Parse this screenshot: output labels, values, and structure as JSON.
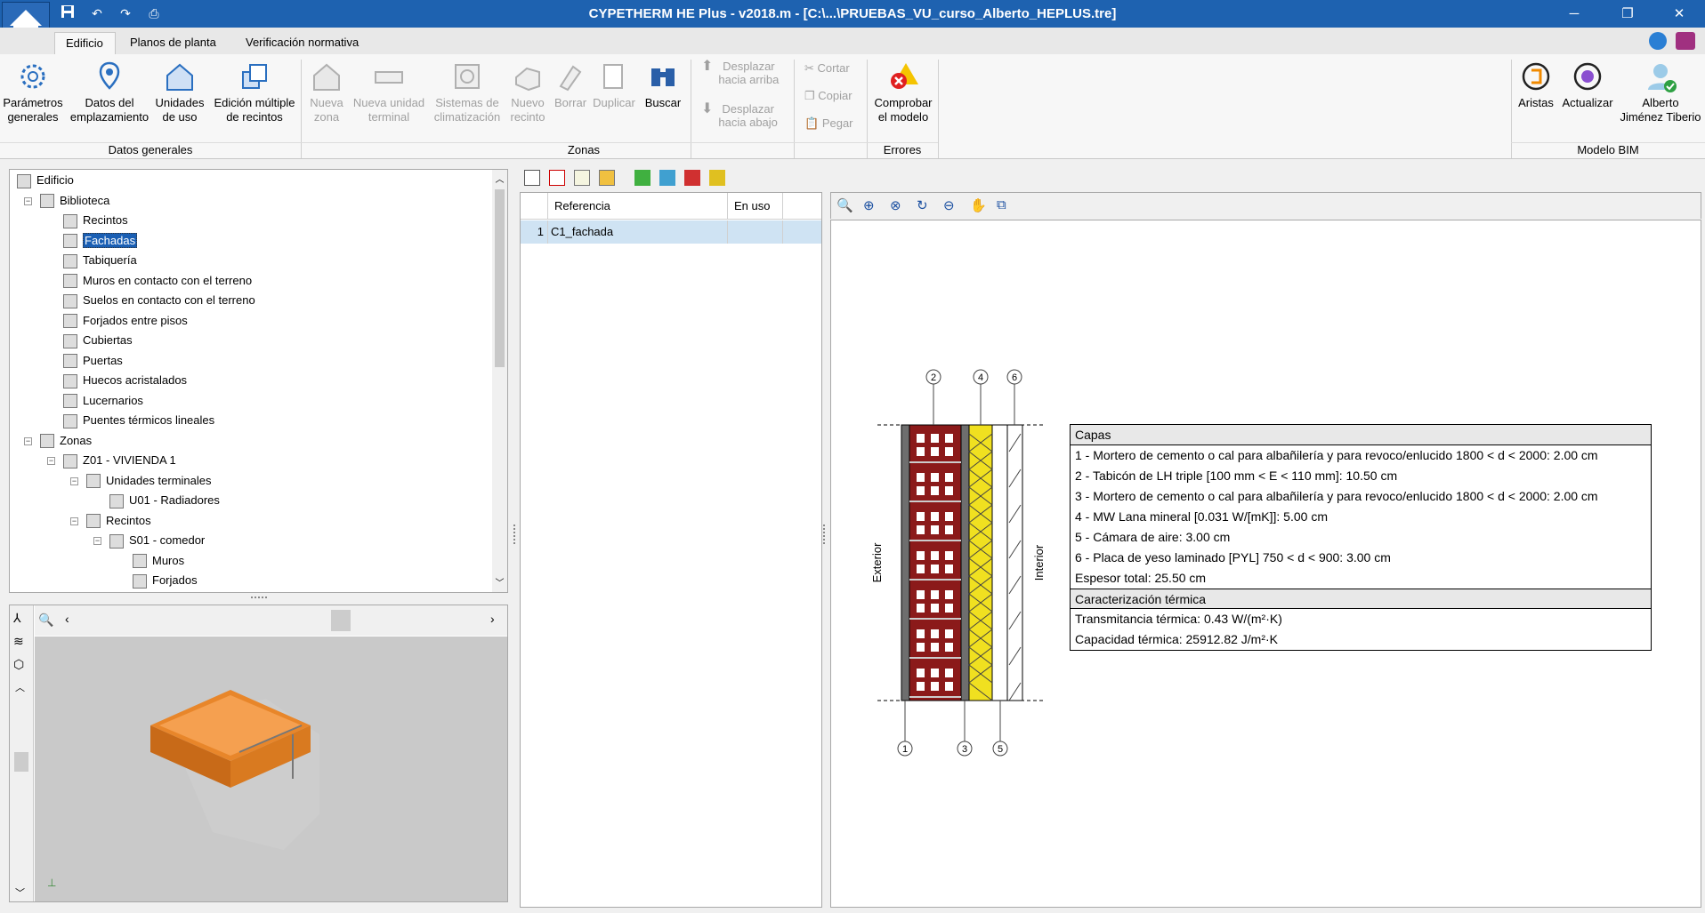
{
  "window": {
    "title": "CYPETHERM HE Plus - v2018.m - [C:\\...\\PRUEBAS_VU_curso_Alberto_HEPLUS.tre]",
    "minimize": "─",
    "restore": "❐",
    "close": "✕"
  },
  "quick_access": {
    "save": "💾",
    "undo": "↶",
    "redo": "↷",
    "print": "⎙"
  },
  "tabs": [
    "Edificio",
    "Planos de planta",
    "Verificación normativa"
  ],
  "ribbon": {
    "datos_generales": {
      "label": "Datos generales",
      "buttons": [
        "Parámetros\ngenerales",
        "Datos del\nemplazamiento",
        "Unidades\nde uso",
        "Edición múltiple\nde recintos"
      ]
    },
    "zonas": {
      "label": "Zonas",
      "buttons": [
        "Nueva\nzona",
        "Nueva unidad\nterminal",
        "Sistemas de\nclimatización",
        "Nuevo\nrecinto",
        "Borrar",
        "Duplicar",
        "Buscar"
      ],
      "move_up": "Desplazar\nhacia arriba",
      "move_down": "Desplazar\nhacia abajo",
      "cut": "Cortar",
      "copy": "Copiar",
      "paste": "Pegar"
    },
    "errores": {
      "label": "Errores",
      "check": "Comprobar\nel modelo"
    },
    "bim": {
      "label": "Modelo BIM",
      "buttons": [
        "Aristas",
        "Actualizar",
        "Alberto\nJiménez Tiberio"
      ]
    }
  },
  "tree": [
    {
      "label": "Edificio",
      "level": 0
    },
    {
      "label": "Biblioteca",
      "level": 1
    },
    {
      "label": "Recintos",
      "level": 2
    },
    {
      "label": "Fachadas",
      "level": 2,
      "selected": true
    },
    {
      "label": "Tabiquería",
      "level": 2
    },
    {
      "label": "Muros en contacto con el terreno",
      "level": 2
    },
    {
      "label": "Suelos en contacto con el terreno",
      "level": 2
    },
    {
      "label": "Forjados entre pisos",
      "level": 2
    },
    {
      "label": "Cubiertas",
      "level": 2
    },
    {
      "label": "Puertas",
      "level": 2
    },
    {
      "label": "Huecos acristalados",
      "level": 2
    },
    {
      "label": "Lucernarios",
      "level": 2
    },
    {
      "label": "Puentes térmicos lineales",
      "level": 2
    },
    {
      "label": "Zonas",
      "level": 1
    },
    {
      "label": "Z01 - VIVIENDA 1",
      "level": 2
    },
    {
      "label": "Unidades terminales",
      "level": 3
    },
    {
      "label": "U01 - Radiadores",
      "level": 4
    },
    {
      "label": "Recintos",
      "level": 3
    },
    {
      "label": "S01 - comedor",
      "level": 4
    },
    {
      "label": "Muros",
      "level": 5
    },
    {
      "label": "Forjados",
      "level": 5
    }
  ],
  "table": {
    "headers": [
      "Referencia",
      "En uso"
    ],
    "rows": [
      {
        "num": "1",
        "ref": "C1_fachada",
        "en_uso": ""
      }
    ]
  },
  "drawing": {
    "layer_numbers": [
      "1",
      "2",
      "3",
      "4",
      "5",
      "6"
    ],
    "exterior": "Exterior",
    "interior": "Interior",
    "capas_header": "Capas",
    "capas": [
      "1 - Mortero de cemento o cal para albañilería y para revoco/enlucido 1800 < d < 2000: 2.00 cm",
      "2 - Tabicón de LH triple [100 mm < E < 110 mm]: 10.50 cm",
      "3 - Mortero de cemento o cal para albañilería y para revoco/enlucido 1800 < d < 2000: 2.00 cm",
      "4 - MW Lana mineral [0.031 W/[mK]]: 5.00 cm",
      "5 - Cámara de aire: 3.00 cm",
      "6 - Placa de yeso laminado [PYL] 750 < d < 900: 3.00 cm",
      "Espesor total: 25.50 cm"
    ],
    "termica_header": "Caracterización térmica",
    "termica": [
      "Transmitancia térmica: 0.43 W/(m²·K)",
      "Capacidad térmica: 25912.82 J/m²·K"
    ]
  },
  "colors": {
    "titlebar": "#1e62b0",
    "selection": "#1a5fb4",
    "brick": "#8b1a1a",
    "insulation": "#f0e020",
    "model": "#e8862a"
  }
}
